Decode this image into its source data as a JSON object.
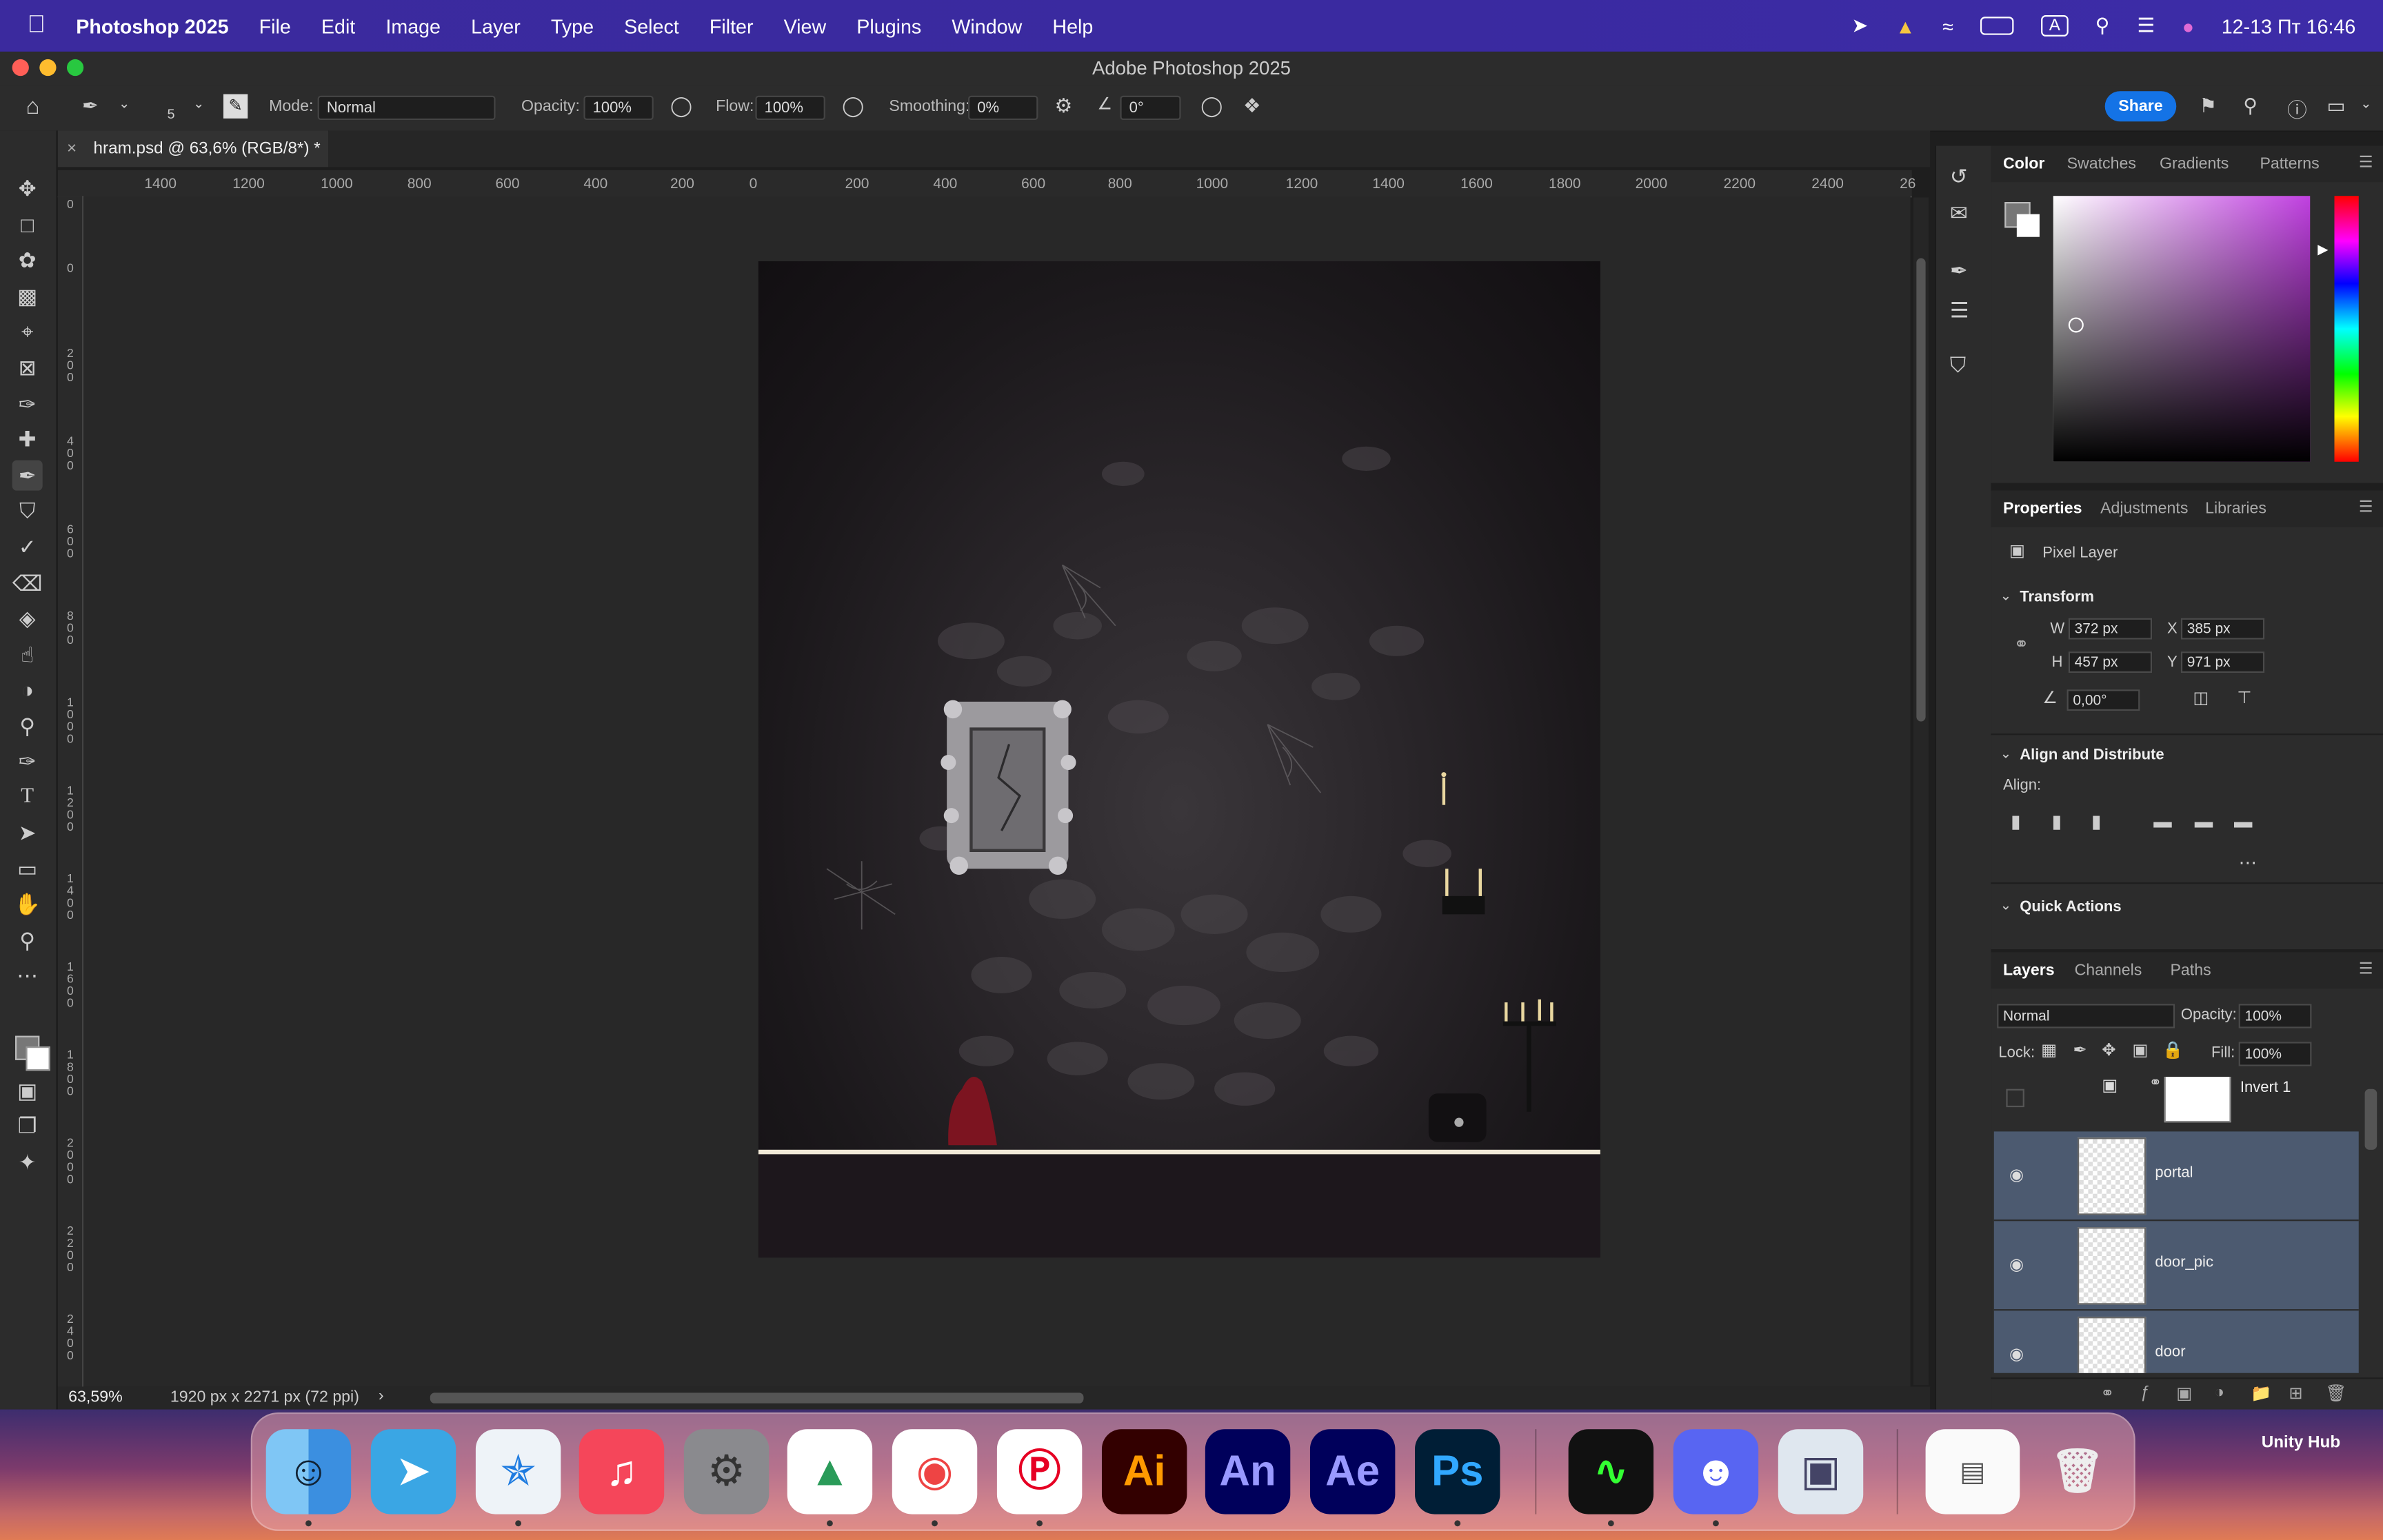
{
  "menubar": {
    "app_name": "Photoshop 2025",
    "menus": [
      "File",
      "Edit",
      "Image",
      "Layer",
      "Type",
      "Select",
      "Filter",
      "View",
      "Plugins",
      "Window",
      "Help"
    ],
    "clock": "12-13 Пт  16:46",
    "input_source": "A"
  },
  "window": {
    "title": "Adobe Photoshop 2025"
  },
  "options": {
    "brush_size": "5",
    "mode_label": "Mode:",
    "mode_value": "Normal",
    "opacity_label": "Opacity:",
    "opacity_value": "100%",
    "flow_label": "Flow:",
    "flow_value": "100%",
    "smoothing_label": "Smoothing:",
    "smoothing_value": "0%",
    "angle_value": "0°",
    "share_label": "Share"
  },
  "document": {
    "tab_title": "hram.psd @ 63,6% (RGB/8*) *",
    "zoom": "63,59%",
    "info": "1920 px x 2271 px (72 ppi)"
  },
  "ruler": {
    "h_ticks": [
      "1400",
      "1200",
      "1000",
      "800",
      "600",
      "400",
      "200",
      "0",
      "200",
      "400",
      "600",
      "800",
      "1000",
      "1200",
      "1400",
      "1600",
      "1800",
      "2000",
      "2200",
      "2400",
      "26"
    ],
    "v_ticks": [
      "0",
      "0",
      "200",
      "400",
      "600",
      "800",
      "1000",
      "1200",
      "1400",
      "1600",
      "1800",
      "2000",
      "2200",
      "2400"
    ]
  },
  "color_panel": {
    "tabs": [
      "Color",
      "Swatches",
      "Gradients",
      "Patterns"
    ],
    "hue_accent": "#c040e0"
  },
  "properties": {
    "tabs": [
      "Properties",
      "Adjustments",
      "Libraries"
    ],
    "layer_kind": "Pixel Layer",
    "transform_title": "Transform",
    "w_label": "W",
    "w": "372 px",
    "h_label": "H",
    "h": "457 px",
    "x_label": "X",
    "x": "385 px",
    "y_label": "Y",
    "y": "971 px",
    "angle": "0,00°",
    "align_title": "Align and Distribute",
    "align_label": "Align:",
    "quick_actions": "Quick Actions"
  },
  "layers_panel": {
    "tabs": [
      "Layers",
      "Channels",
      "Paths"
    ],
    "blend_mode": "Normal",
    "opacity_label": "Opacity:",
    "opacity": "100%",
    "lock_label": "Lock:",
    "fill_label": "Fill:",
    "fill": "100%",
    "layers": [
      {
        "name": "Invert 1"
      },
      {
        "name": "portal"
      },
      {
        "name": "door_pic"
      },
      {
        "name": "door"
      }
    ]
  },
  "dock": {
    "unity_hub_label": "Unity Hub",
    "apps": [
      "Finder",
      "Telegram",
      "Safari",
      "Music",
      "System Settings",
      "Krita",
      "Chrome",
      "Pinterest",
      "Ai",
      "An",
      "Ae",
      "Ps",
      "Activity Monitor",
      "Discord",
      "Preview"
    ]
  }
}
